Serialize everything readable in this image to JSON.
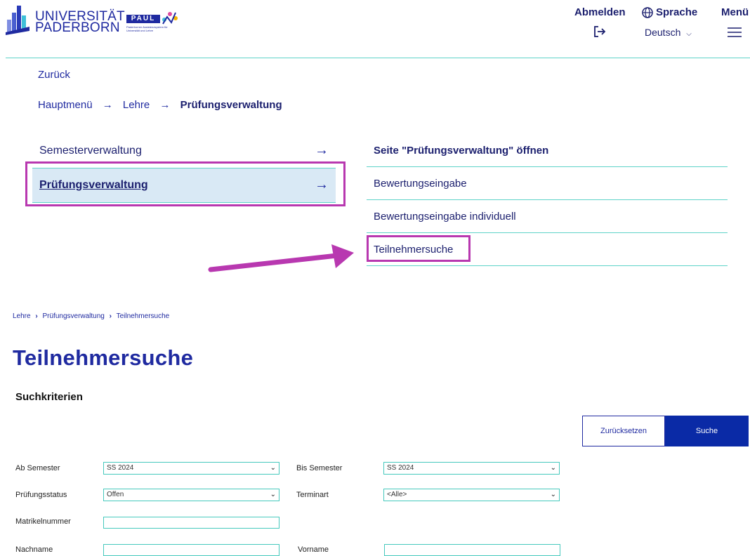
{
  "header": {
    "university_line1": "UNIVERSITÄT",
    "university_line2": "PADERBORN",
    "paul_word": "PAUL",
    "paul_tagline": "Paderborner Assistenzsystem für Universität und Lehre",
    "logout_label": "Abmelden",
    "language_label": "Sprache",
    "language_value": "Deutsch",
    "menu_label": "Menü"
  },
  "nav": {
    "back_label": "Zurück",
    "breadcrumb": [
      "Hauptmenü",
      "Lehre",
      "Prüfungsverwaltung"
    ],
    "menu_items": [
      {
        "label": "Semesterverwaltung"
      },
      {
        "label": "Prüfungsverwaltung"
      }
    ],
    "submenu_items": [
      {
        "label": "Seite \"Prüfungsverwaltung\" öffnen"
      },
      {
        "label": "Bewertungseingabe"
      },
      {
        "label": "Bewertungseingabe individuell"
      },
      {
        "label": "Teilnehmersuche"
      }
    ]
  },
  "page": {
    "breadcrumb": [
      "Lehre",
      "Prüfungsverwaltung",
      "Teilnehmersuche"
    ],
    "title": "Teilnehmersuche",
    "section_title": "Suchkriterien",
    "reset_button": "Zurücksetzen",
    "search_button": "Suche",
    "fields": {
      "ab_semester": {
        "label": "Ab Semester",
        "value": "SS 2024"
      },
      "bis_semester": {
        "label": "Bis Semester",
        "value": "SS 2024"
      },
      "pruefungsstatus": {
        "label": "Prüfungsstatus",
        "value": "Offen"
      },
      "terminart": {
        "label": "Terminart",
        "value": "<Alle>"
      },
      "matrikelnummer": {
        "label": "Matrikelnummer",
        "value": ""
      },
      "nachname": {
        "label": "Nachname",
        "value": ""
      },
      "vorname": {
        "label": "Vorname",
        "value": ""
      }
    }
  },
  "colors": {
    "brand_blue": "#1f2aa0",
    "accent_teal": "#5ed3c8",
    "annotation_magenta": "#b838b0",
    "active_bg": "#d9e9f5"
  }
}
